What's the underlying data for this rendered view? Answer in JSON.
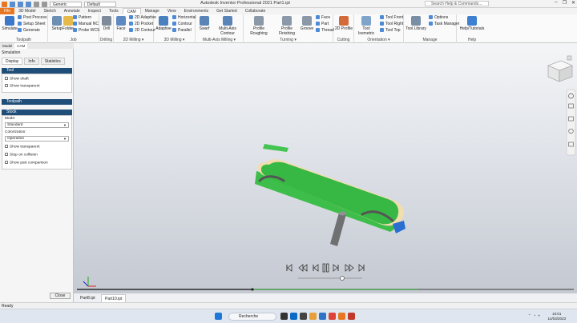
{
  "titlebar": {
    "app_title": "Autodesk Inventor Professional 2021    Part1.ipt",
    "generic_combo": "Generic",
    "default_combo": "Default",
    "search_placeholder": "Search Help & Commands...",
    "min": "–",
    "max": "❐",
    "close": "✕"
  },
  "menu_tabs": [
    "File",
    "3D Model",
    "Sketch",
    "Annotate",
    "Inspect",
    "Tools",
    "CAM",
    "Manage",
    "View",
    "Environments",
    "Get Started",
    "Collaborate"
  ],
  "ribbon": {
    "toolpath": {
      "label": "Toolpath",
      "simulate": "Simulate",
      "post_process": "Post Process",
      "setup_sheet": "Setup Sheet",
      "generate": "Generate"
    },
    "job": {
      "label": "Job",
      "setup": "Setup",
      "folder": "Folder",
      "pattern": "Pattern",
      "manual_nc": "Manual NC",
      "probe_wcs": "Probe WCS"
    },
    "drilling": {
      "label": "Drilling",
      "drill": "Drill"
    },
    "milling2d": {
      "label": "2D Milling ▾",
      "face": "Face",
      "adaptive2d": "2D Adaptive",
      "pocket2d": "2D Pocket",
      "contour2d": "2D Contour"
    },
    "milling3d": {
      "label": "3D Milling ▾",
      "adaptive": "Adaptive",
      "horizontal": "Horizontal",
      "contour": "Contour",
      "parallel": "Parallel"
    },
    "multiaxis": {
      "label": "Multi-Axis Milling ▾",
      "swarf": "Swarf",
      "multi_contour": "Multi-Axis Contour"
    },
    "turning": {
      "label": "Turning ▾",
      "profile_roughing": "Profile Roughing",
      "profile_finishing": "Profile Finishing",
      "groove": "Groove",
      "face": "Face",
      "part": "Part",
      "thread": "Thread"
    },
    "cutting": {
      "label": "Cutting",
      "profile2d": "2D Profile"
    },
    "orientation": {
      "label": "Orientation ▾",
      "tool_isometric": "Tool Isometric",
      "tool_front": "Tool Front",
      "tool_right": "Tool Right",
      "tool_top": "Tool Top"
    },
    "manage": {
      "label": "Manage",
      "tool_library": "Tool Library",
      "options": "Options",
      "task_manager": "Task Manager"
    },
    "help": {
      "label": "Help",
      "help_tutorials": "Help/Tutorials"
    }
  },
  "left_panel": {
    "panel_tabs": [
      "Model",
      "CAM"
    ],
    "panel_title": "Simulation",
    "subtabs": [
      "Display",
      "Info",
      "Statistics"
    ],
    "tool_section": {
      "title": "Tool",
      "show_shaft": "Show shaft",
      "show_transparent": "Show transparent"
    },
    "toolpath_section": {
      "title": "Toolpath"
    },
    "stock_section": {
      "title": "Stock",
      "mode_label": "Mode:",
      "mode_value": "Standard",
      "colorization_label": "Colorization:",
      "colorization_value": "Operation",
      "show_transparent": "Show transparent",
      "stop_on_collision": "Stop on collision",
      "show_part_comparison": "Show part comparison"
    },
    "close_button": "Close"
  },
  "doc_tabs": [
    "Part8.ipt",
    "Part10.ipt"
  ],
  "status_text": "Ready",
  "taskbar": {
    "search": "Recherche",
    "time": "10:01",
    "date": "14/03/2023"
  },
  "colors": {
    "file_tab": "#e87722",
    "section_header": "#1f4e79",
    "stock_green": "#3ec04a",
    "stock_tan": "#f2deae",
    "tool_gray": "#6f7072",
    "blue_accent": "#2a6fd0"
  }
}
